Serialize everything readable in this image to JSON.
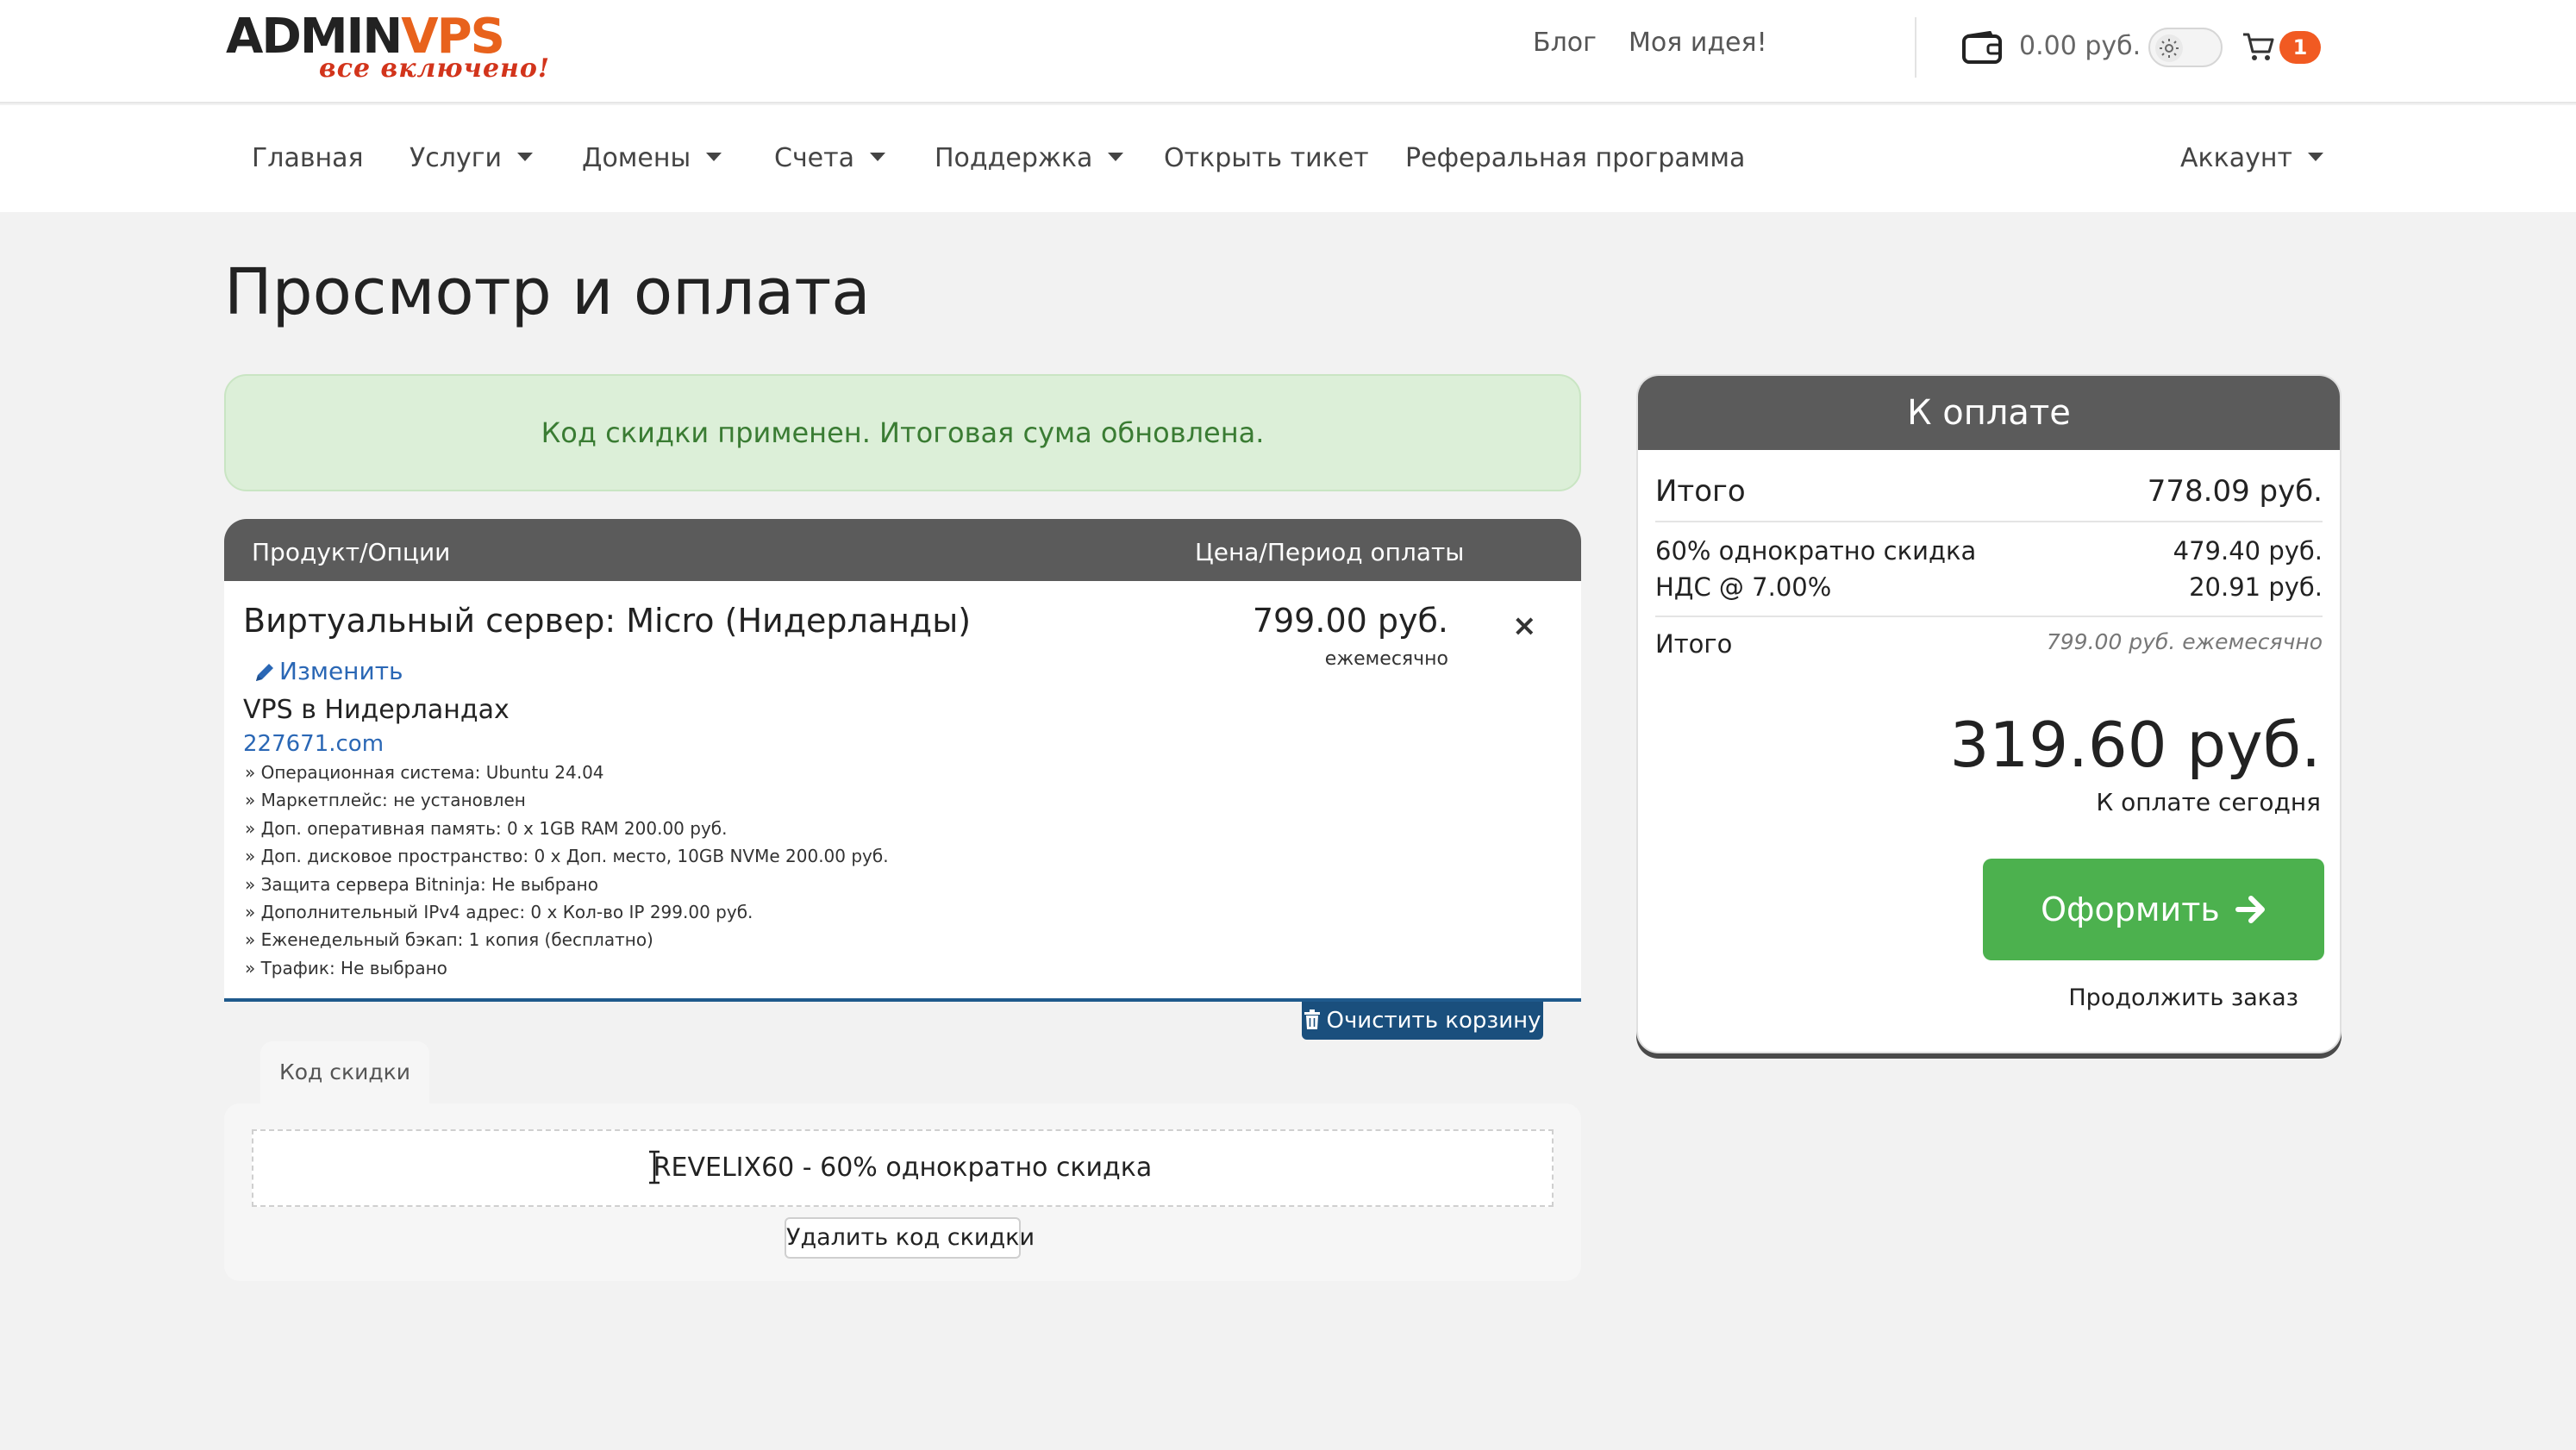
{
  "header": {
    "logo": {
      "text_main_a": "ADMIN",
      "text_main_b": "VPS",
      "tagline": "все включено!"
    },
    "links": {
      "blog": "Блог",
      "idea": "Моя идея!"
    },
    "balance": "0.00 руб.",
    "cart_count": "1"
  },
  "nav": {
    "home": "Главная",
    "services": "Услуги",
    "domains": "Домены",
    "billing": "Счета",
    "support": "Поддержка",
    "open_ticket": "Открыть тикет",
    "referral": "Реферальная программа",
    "account": "Аккаунт"
  },
  "page": {
    "title": "Просмотр и оплата",
    "alert": "Код скидки применен. Итоговая сума обновлена."
  },
  "cart": {
    "headers": {
      "product": "Продукт/Опции",
      "price": "Цена/Период оплаты"
    },
    "item": {
      "title": "Виртуальный сервер: Micro (Нидерланды)",
      "edit": "Изменить",
      "group": "VPS в Нидерландах",
      "domain": "227671.com",
      "price": "799.00 руб.",
      "period": "ежемесячно",
      "remove": "×",
      "options": [
        "» Операционная система: Ubuntu 24.04",
        "» Маркетплейс: не установлен",
        "» Доп. оперативная память: 0 x 1GB RAM 200.00 руб.",
        "» Доп. дисковое пространство: 0 x Доп. место, 10GB NVMe 200.00 руб.",
        "» Защита сервера Bitninja: Не выбрано",
        "» Дополнительный IPv4 адрес: 0 x Кол-во IP 299.00 руб.",
        "» Еженедельный бэкап: 1 копия (бесплатно)",
        "» Трафик: Не выбрано"
      ]
    },
    "clear_cart": "Очистить корзину"
  },
  "promo": {
    "tab": "Код скидки",
    "applied": "REVELIX60 - 60% однократно скидка",
    "remove_button": "Удалить код скидки"
  },
  "summary": {
    "title": "К оплате",
    "subtotal_label": "Итого",
    "subtotal_value": "778.09 руб.",
    "discount_label": "60% однократно скидка",
    "discount_value": "479.40 руб.",
    "tax_label": "НДС @ 7.00%",
    "tax_value": "20.91 руб.",
    "recurring_label": "Итого",
    "recurring_value": "799.00 руб. ежемесячно",
    "due_today": "319.60 руб.",
    "due_today_caption": "К оплате сегодня",
    "checkout": "Оформить",
    "continue": "Продолжить заказ"
  },
  "colors": {
    "accent_orange": "#e8621c",
    "success_green": "#4cb14e",
    "alert_bg": "#dcefd8",
    "header_gray": "#5b5b5b",
    "link_blue": "#2a67b5",
    "clear_cart_blue": "#1a4f7d"
  }
}
